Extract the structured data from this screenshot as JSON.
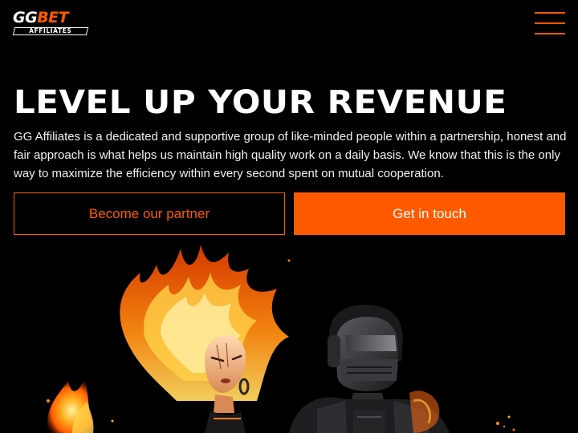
{
  "header": {
    "logo": {
      "top_white": "GG",
      "top_orange": "BET",
      "bottom": "AFFILIATES"
    },
    "menu_icon": "hamburger-menu-icon"
  },
  "hero": {
    "headline": "LEVEL UP YOUR REVENUE",
    "description": "GG Affiliates is a dedicated and supportive group of like-minded people within a partnership, honest and fair approach is what helps us maintain high quality work on a daily basis. We know that this is the only way to maximize the efficiency within every second spent on mutual cooperation.",
    "buttons": {
      "partner": "Become our partner",
      "contact": "Get in touch"
    },
    "illustration": [
      "flame-haired-character",
      "masked-soldier-character"
    ]
  },
  "colors": {
    "accent": "#ff5a00",
    "background": "#000000",
    "text": "#ffffff"
  }
}
